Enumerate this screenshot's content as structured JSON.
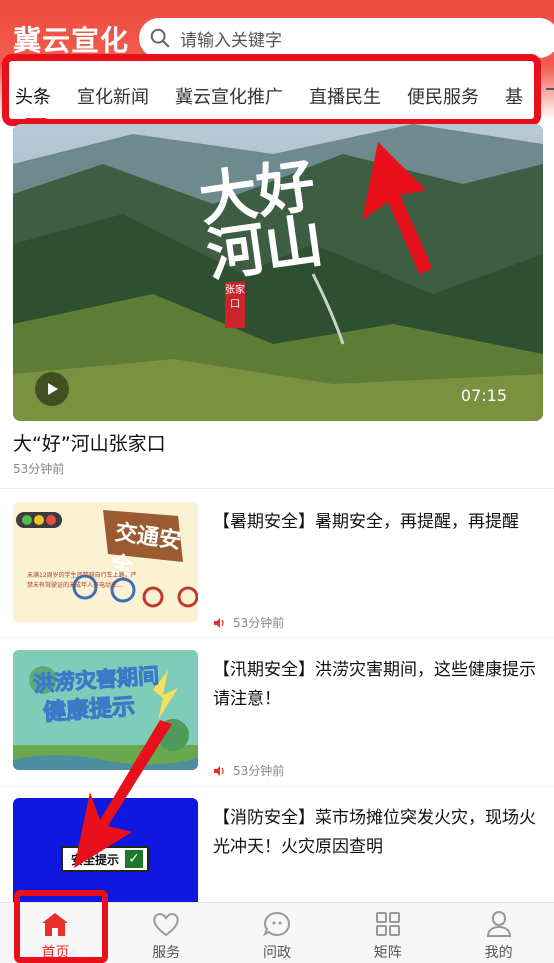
{
  "header": {
    "brand": "冀云宣化",
    "search_placeholder": "请输入关键字"
  },
  "tabs": [
    "头条",
    "宣化新闻",
    "冀云宣化推广",
    "直播民生",
    "便民服务",
    "基"
  ],
  "hero": {
    "overlay_title": "大好河山",
    "seal_text": "张家口",
    "duration": "07:15",
    "caption": "大“好”河山张家口",
    "time": "53分钟前"
  },
  "news": [
    {
      "headline": "【暑期安全】暑期安全，再提醒，再提醒",
      "time": "53分钟前",
      "thumb_title": "交通安全",
      "thumb_lines": [
        "未满12周岁的学生严禁骑自行车上路，严",
        "禁未有驾驶证的未成年人开电动车…"
      ]
    },
    {
      "headline": "【汛期安全】洪涝灾害期间，这些健康提示请注意！",
      "time": "53分钟前",
      "thumb_title_1": "洪涝灾害期间",
      "thumb_title_2": "健康提示"
    },
    {
      "headline": "【消防安全】菜市场摊位突发火灾，现场火光冲天！火灾原因查明",
      "thumb_badge": "安全提示"
    }
  ],
  "bottom_nav": [
    {
      "label": "首页",
      "icon": "home-icon",
      "active": true
    },
    {
      "label": "服务",
      "icon": "heart-icon"
    },
    {
      "label": "问政",
      "icon": "chat-icon"
    },
    {
      "label": "矩阵",
      "icon": "grid-icon"
    },
    {
      "label": "我的",
      "icon": "user-icon"
    }
  ],
  "colors": {
    "brand_red": "#ef4a3e",
    "annotation_red": "#e8101a",
    "active_tab_indicator": "#e8302a"
  }
}
